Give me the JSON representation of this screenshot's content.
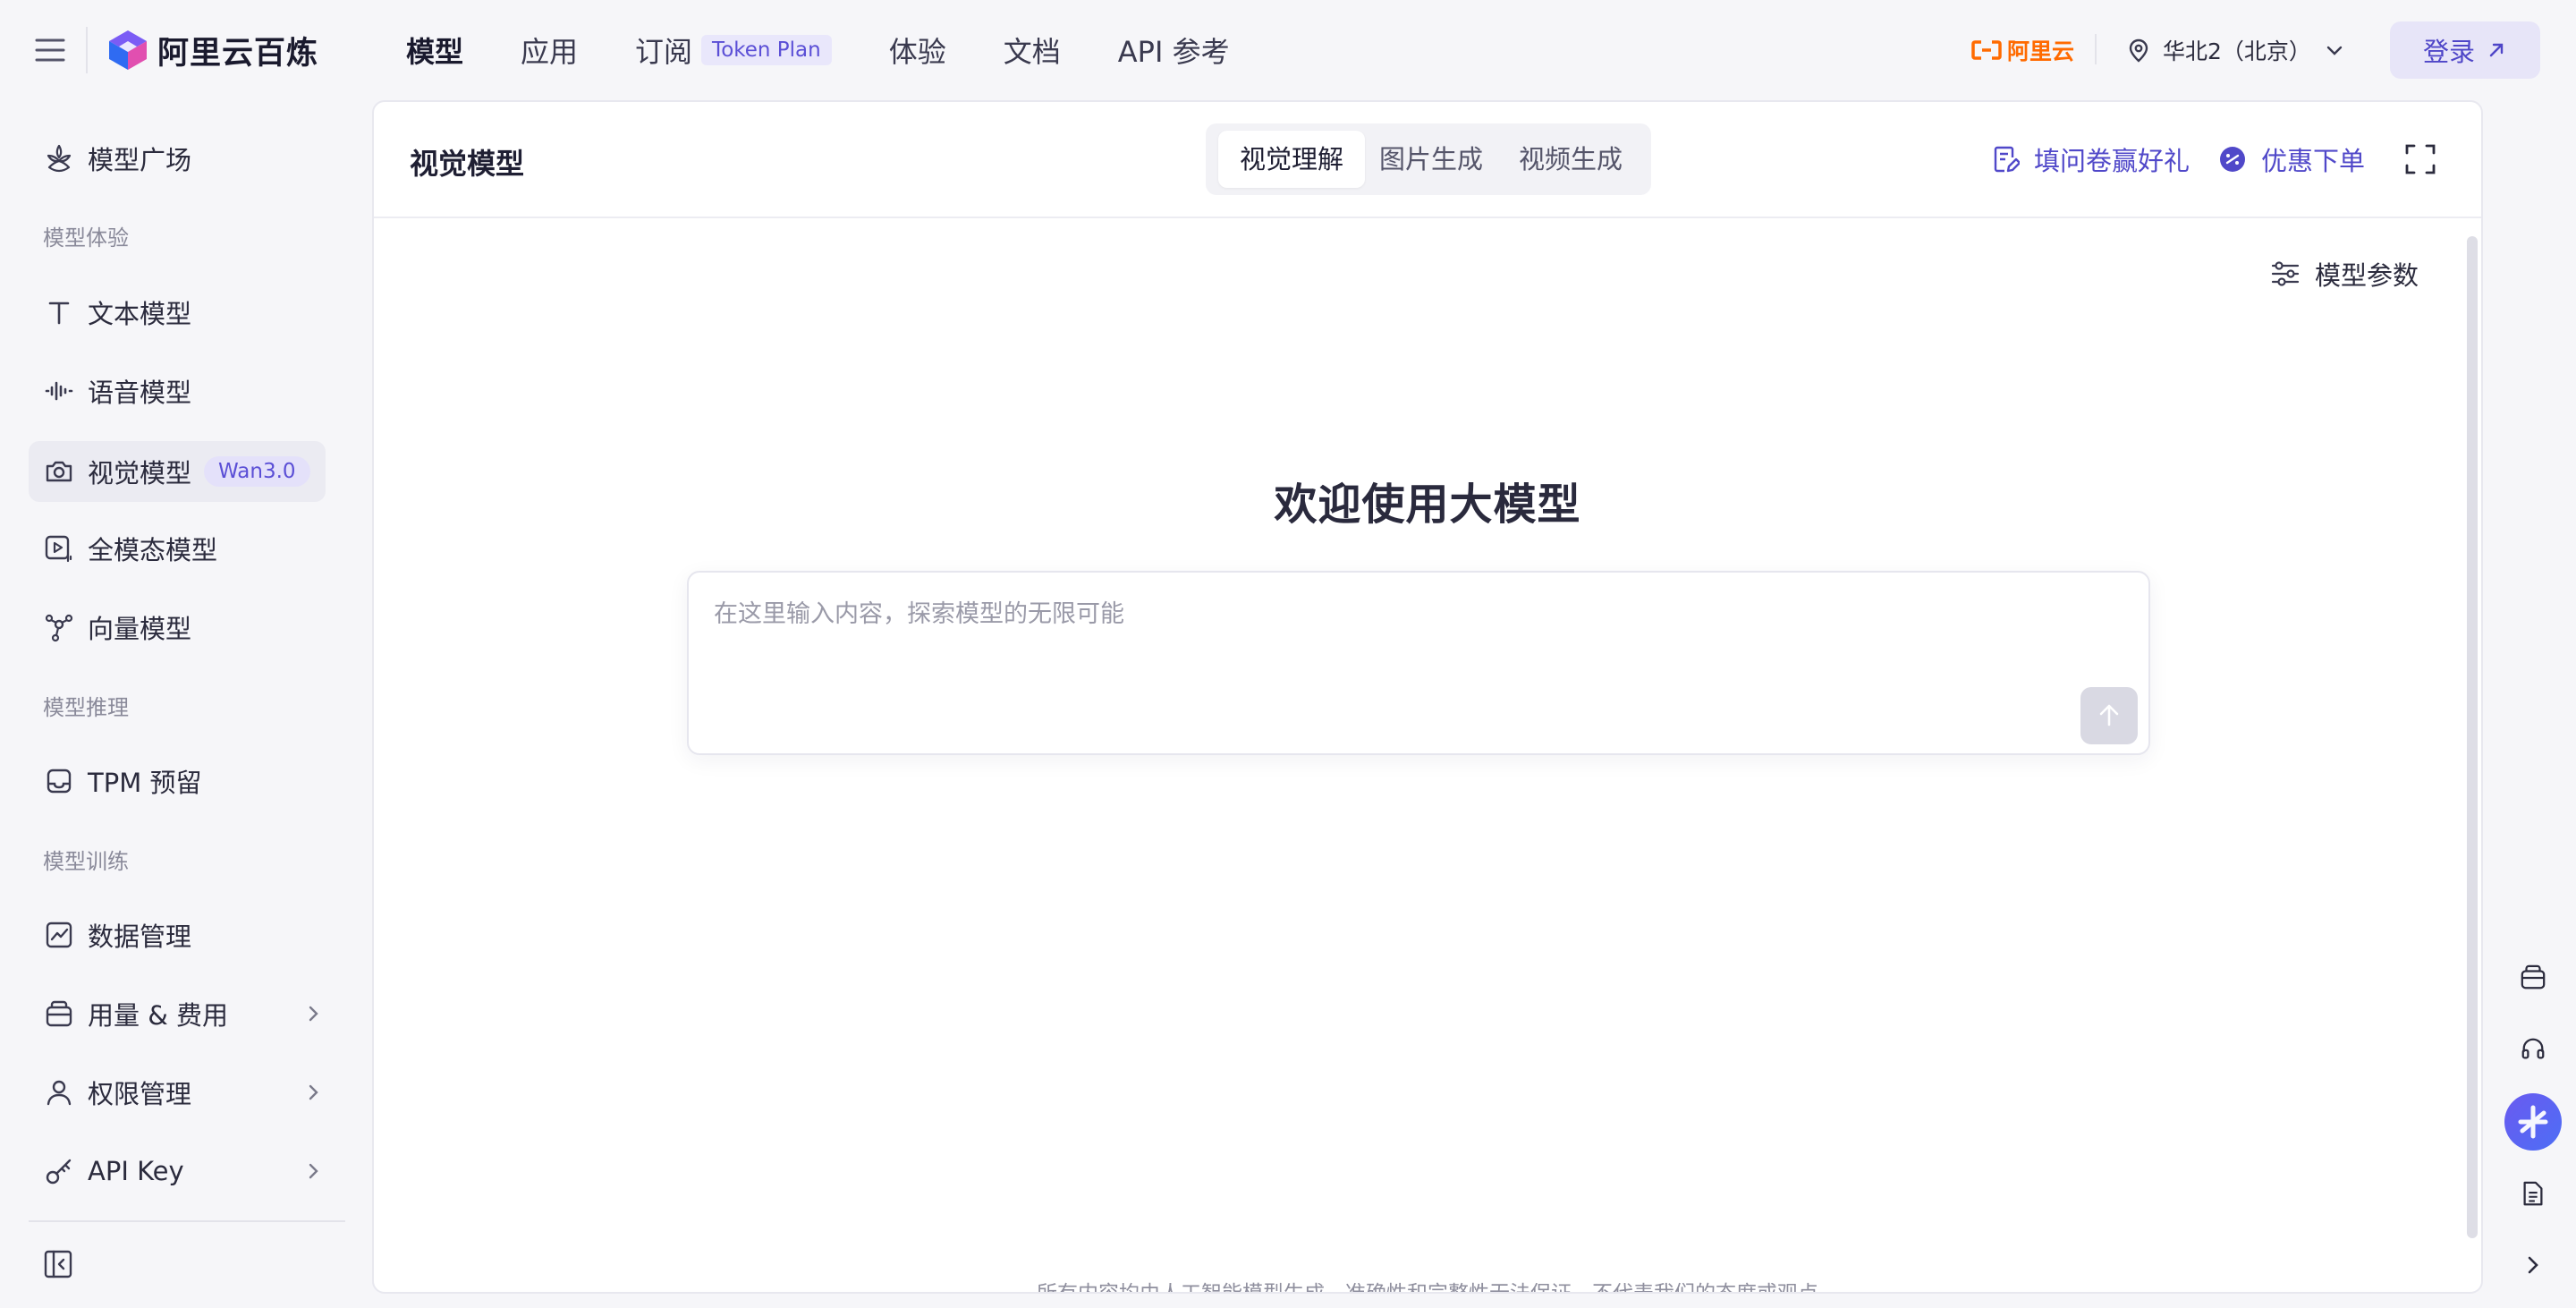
{
  "header": {
    "logo_text": "阿里云百炼",
    "nav": [
      {
        "label": "模型"
      },
      {
        "label": "应用"
      },
      {
        "label": "订阅",
        "badge": "Token Plan"
      },
      {
        "label": "体验"
      },
      {
        "label": "文档"
      },
      {
        "label": "API 参考"
      }
    ],
    "brand_label": "阿里云",
    "region": "华北2（北京）",
    "login_label": "登录"
  },
  "sidebar": {
    "model_square": "模型广场",
    "sections": {
      "experience": "模型体验",
      "inference": "模型推理",
      "training": "模型训练"
    },
    "items": [
      {
        "label": "文本模型",
        "icon": "text-icon"
      },
      {
        "label": "语音模型",
        "icon": "waveform-icon"
      },
      {
        "label": "视觉模型",
        "icon": "camera-icon",
        "badge": "Wan3.0",
        "active": true
      },
      {
        "label": "全模态模型",
        "icon": "multimodal-icon"
      },
      {
        "label": "向量模型",
        "icon": "vector-icon"
      },
      {
        "label": "TPM 预留",
        "icon": "inbox-icon"
      },
      {
        "label": "数据管理",
        "icon": "chart-icon"
      },
      {
        "label": "用量 & 费用",
        "icon": "wallet-icon"
      },
      {
        "label": "权限管理",
        "icon": "user-icon"
      },
      {
        "label": "API Key",
        "icon": "key-icon"
      }
    ]
  },
  "main": {
    "title": "视觉模型",
    "tabs": [
      {
        "label": "视觉理解",
        "active": true
      },
      {
        "label": "图片生成"
      },
      {
        "label": "视频生成"
      }
    ],
    "survey_label": "填问卷赢好礼",
    "discount_label": "优惠下单",
    "params_label": "模型参数",
    "welcome": "欢迎使用大模型",
    "input_placeholder": "在这里输入内容，探索模型的无限可能",
    "footer_note": "所有内容均由人工智能模型生成，准确性和完整性无法保证，不代表我们的态度或观点"
  },
  "colors": {
    "accent": "#5048c9",
    "brand_orange": "#ff6a00",
    "badge_bg": "#e4e1fa",
    "active_bg": "#ebebf2",
    "page_bg": "#f6f6f9"
  }
}
